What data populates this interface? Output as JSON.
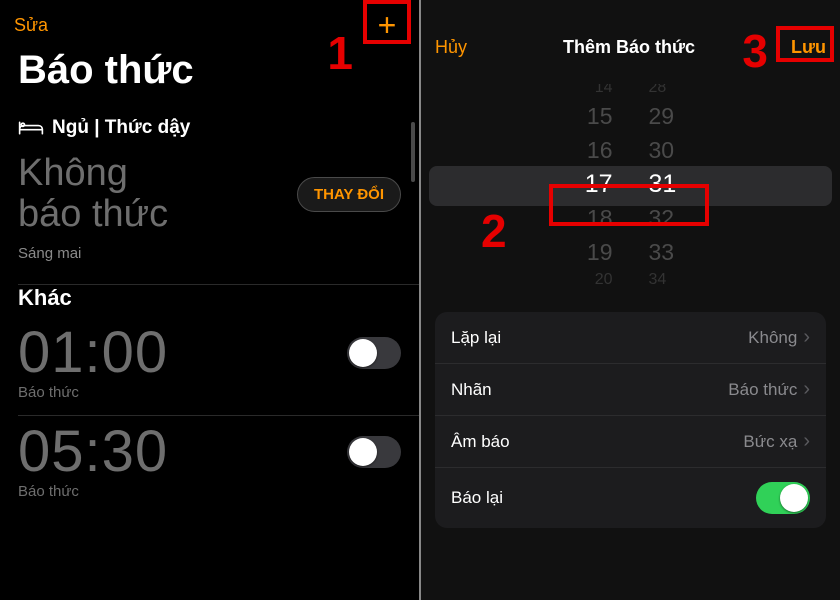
{
  "colors": {
    "accent": "#ff9500",
    "annotation": "#e60000",
    "toggle_on": "#30d158"
  },
  "annotations": {
    "n1": "1",
    "n2": "2",
    "n3": "3"
  },
  "left": {
    "nav_edit": "Sửa",
    "add_icon_label": "Thêm",
    "big_title": "Báo thức",
    "sleep_section_title": "Ngủ | Thức dậy",
    "no_alarm_line1": "Không",
    "no_alarm_line2": "báo thức",
    "change_btn": "THAY ĐỔI",
    "tomorrow_label": "Sáng mai",
    "other_section_title": "Khác",
    "alarms": [
      {
        "time": "01:00",
        "label": "Báo thức",
        "on": false
      },
      {
        "time": "05:30",
        "label": "Báo thức",
        "on": false
      }
    ]
  },
  "right": {
    "cancel": "Hủy",
    "title": "Thêm Báo thức",
    "save": "Lưu",
    "picker": {
      "hours": {
        "pre2": "14",
        "pre1": "15",
        "prev": "16",
        "sel": "17",
        "next": "18",
        "post1": "19",
        "post2": "20"
      },
      "minutes": {
        "pre2": "28",
        "pre1": "29",
        "prev": "30",
        "sel": "31",
        "next": "32",
        "post1": "33",
        "post2": "34"
      }
    },
    "settings": {
      "repeat_label": "Lặp lại",
      "repeat_value": "Không",
      "name_label": "Nhãn",
      "name_value": "Báo thức",
      "sound_label": "Âm báo",
      "sound_value": "Bức xạ",
      "snooze_label": "Báo lại",
      "snooze_on": true
    }
  }
}
